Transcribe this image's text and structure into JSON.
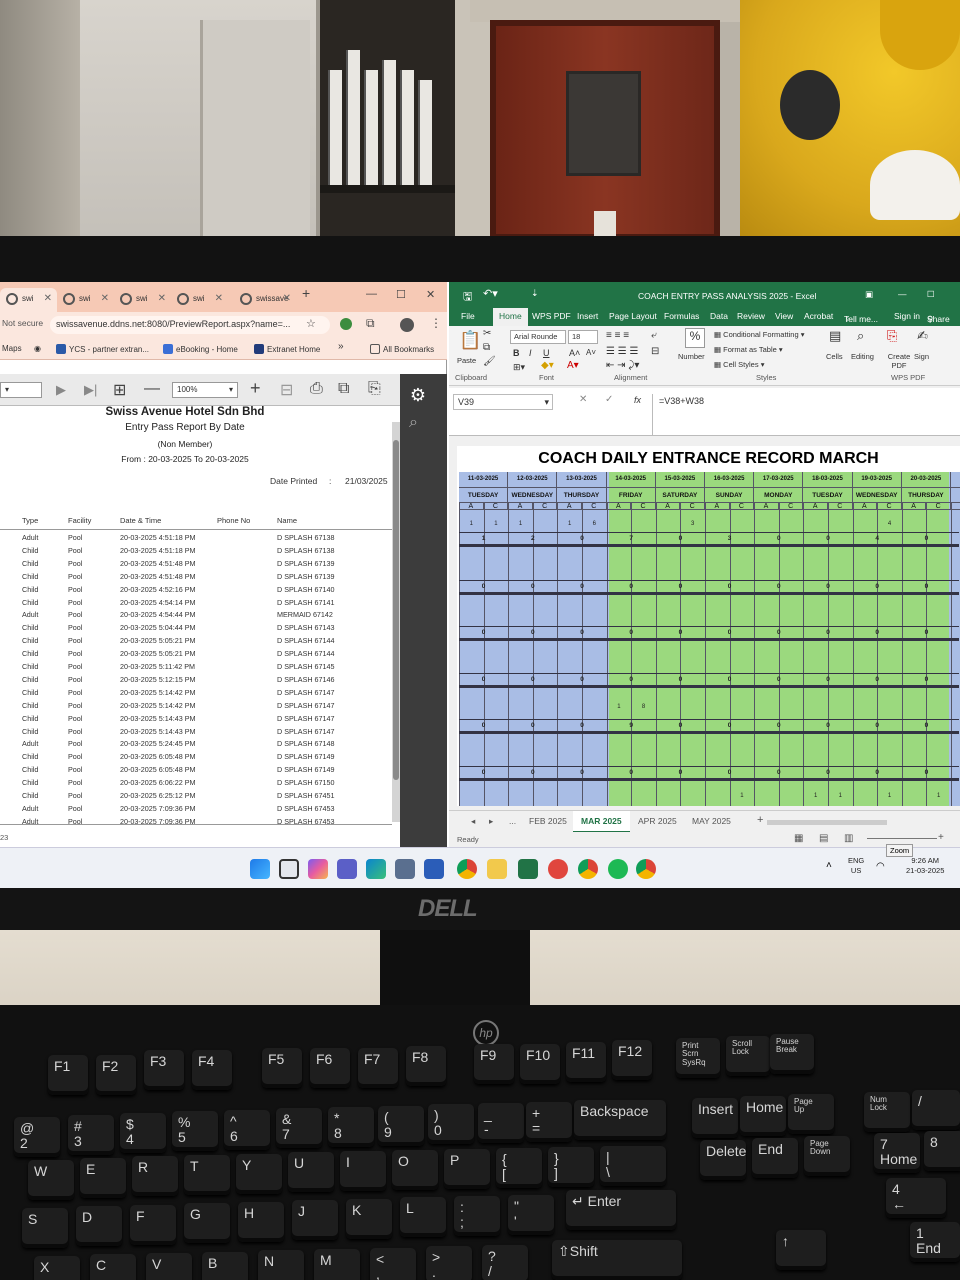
{
  "browser": {
    "tabs": [
      {
        "label": "swi",
        "active": true
      },
      {
        "label": "swi",
        "active": false
      },
      {
        "label": "swi",
        "active": false
      },
      {
        "label": "swi",
        "active": false
      },
      {
        "label": "swissave",
        "active": false
      }
    ],
    "not_secure": "Not secure",
    "url": "swissavenue.ddns.net:8080/PreviewReport.aspx?name=...",
    "bookmarks": [
      "Maps",
      "YCS - partner extran...",
      "eBooking - Home",
      "Extranet Home",
      "All Bookmarks"
    ],
    "zoom": "100%",
    "report": {
      "company": "Swiss Avenue Hotel Sdn Bhd",
      "title": "Entry Pass Report By Date",
      "subtitle": "(Non Member)",
      "range": "From : 20-03-2025 To 20-03-2025",
      "printed_label": "Date Printed",
      "printed_sep": ":",
      "printed_value": "21/03/2025",
      "columns": [
        "Type",
        "Facility",
        "Date & Time",
        "Phone No",
        "Name"
      ],
      "rows": [
        [
          "Adult",
          "Pool",
          "20-03-2025 4:51:18 PM",
          "D SPLASH 67138"
        ],
        [
          "Child",
          "Pool",
          "20-03-2025 4:51:18 PM",
          "D SPLASH 67138"
        ],
        [
          "Child",
          "Pool",
          "20-03-2025 4:51:48 PM",
          "D SPLASH 67139"
        ],
        [
          "Child",
          "Pool",
          "20-03-2025 4:51:48 PM",
          "D SPLASH 67139"
        ],
        [
          "Child",
          "Pool",
          "20-03-2025 4:52:16 PM",
          "D SPLASH 67140"
        ],
        [
          "Child",
          "Pool",
          "20-03-2025 4:54:14 PM",
          "D SPLASH 67141"
        ],
        [
          "Adult",
          "Pool",
          "20-03-2025 4:54:44 PM",
          "MERMAID 67142"
        ],
        [
          "Child",
          "Pool",
          "20-03-2025 5:04:44 PM",
          "D SPLASH 67143"
        ],
        [
          "Child",
          "Pool",
          "20-03-2025 5:05:21 PM",
          "D SPLASH 67144"
        ],
        [
          "Child",
          "Pool",
          "20-03-2025 5:05:21 PM",
          "D SPLASH 67144"
        ],
        [
          "Child",
          "Pool",
          "20-03-2025 5:11:42 PM",
          "D SPLASH 67145"
        ],
        [
          "Child",
          "Pool",
          "20-03-2025 5:12:15 PM",
          "D SPLASH 67146"
        ],
        [
          "Child",
          "Pool",
          "20-03-2025 5:14:42 PM",
          "D SPLASH 67147"
        ],
        [
          "Child",
          "Pool",
          "20-03-2025 5:14:42 PM",
          "D SPLASH 67147"
        ],
        [
          "Child",
          "Pool",
          "20-03-2025 5:14:43 PM",
          "D SPLASH 67147"
        ],
        [
          "Child",
          "Pool",
          "20-03-2025 5:14:43 PM",
          "D SPLASH 67147"
        ],
        [
          "Adult",
          "Pool",
          "20-03-2025 5:24:45 PM",
          "D SPLASH 67148"
        ],
        [
          "Child",
          "Pool",
          "20-03-2025 6:05:48 PM",
          "D SPLASH 67149"
        ],
        [
          "Child",
          "Pool",
          "20-03-2025 6:05:48 PM",
          "D SPLASH 67149"
        ],
        [
          "Child",
          "Pool",
          "20-03-2025 6:06:22 PM",
          "D SPLASH 67150"
        ],
        [
          "Child",
          "Pool",
          "20-03-2025 6:25:12 PM",
          "D SPLASH 67451"
        ],
        [
          "Adult",
          "Pool",
          "20-03-2025 7:09:36 PM",
          "D SPLASH 67453"
        ],
        [
          "Adult",
          "Pool",
          "20-03-2025 7:09:36 PM",
          "D SPLASH 67453"
        ]
      ],
      "page_indicator": "23"
    }
  },
  "excel": {
    "window_title": "COACH ENTRY PASS ANALYSIS 2025 - Excel",
    "menu": [
      "File",
      "Home",
      "WPS PDF",
      "Insert",
      "Page Layout",
      "Formulas",
      "Data",
      "Review",
      "View",
      "Acrobat",
      "Tell me...",
      "Sign in",
      "Share"
    ],
    "font_name": "Arial Rounde",
    "font_size": "18",
    "ribbon_labels": {
      "paste": "Paste",
      "number": "Number",
      "conditional": "Conditional Formatting",
      "format_table": "Format as Table",
      "cell_styles": "Cell Styles",
      "cells": "Cells",
      "editing": "Editing",
      "create_pdf": "Create PDF",
      "sign": "Sign",
      "clipboard": "Clipboard",
      "font": "Font",
      "alignment": "Alignment",
      "styles": "Styles",
      "wps_pdf": "WPS PDF"
    },
    "name_box": "V39",
    "formula": "=V38+W38",
    "sheet_title": "COACH DAILY ENTRANCE RECORD MARCH",
    "dates": [
      "11-03-2025",
      "12-03-2025",
      "13-03-2025",
      "14-03-2025",
      "15-03-2025",
      "16-03-2025",
      "17-03-2025",
      "18-03-2025",
      "19-03-2025",
      "20-03-2025",
      "21-0"
    ],
    "days": [
      "TUESDAY",
      "WEDNESDAY",
      "THURSDAY",
      "FRIDAY",
      "SATURDAY",
      "SUNDAY",
      "MONDAY",
      "TUESDAY",
      "WEDNESDAY",
      "THURSDAY",
      "F"
    ],
    "ac_label_a": "A",
    "ac_label_c": "C",
    "first_row_small": [
      "1",
      "1",
      "1",
      "",
      "1",
      "6",
      "",
      "",
      "",
      "3",
      "",
      "",
      "",
      "",
      "",
      "",
      "",
      "4",
      "",
      ""
    ],
    "totals": [
      [
        "1",
        "2",
        "0",
        "7",
        "0",
        "3",
        "0",
        "0",
        "4",
        "0"
      ],
      [
        "0",
        "0",
        "0",
        "0",
        "0",
        "0",
        "0",
        "0",
        "0",
        "0"
      ],
      [
        "0",
        "0",
        "0",
        "0",
        "0",
        "0",
        "0",
        "0",
        "0",
        "0"
      ],
      [
        "0",
        "0",
        "0",
        "0",
        "0",
        "0",
        "0",
        "0",
        "0",
        "0"
      ],
      [
        "0",
        "0",
        "0",
        "9",
        "0",
        "0",
        "0",
        "0",
        "0",
        "0"
      ],
      [
        "0",
        "0",
        "0",
        "0",
        "0",
        "0",
        "0",
        "0",
        "0",
        "0"
      ]
    ],
    "row5_small": [
      "1",
      "8"
    ],
    "bottom_small": [
      "1",
      "1",
      "1",
      "1",
      "1"
    ],
    "sheet_tabs": [
      "...",
      "FEB 2025",
      "MAR 2025",
      "APR 2025",
      "MAY 2025",
      "+"
    ],
    "status": "Ready"
  },
  "taskbar": {
    "lang": "ENG",
    "region": "US",
    "time": "9:26 AM",
    "date": "21-03-2025",
    "zoom_tooltip": "Zoom"
  },
  "monitor_brand": "DELL",
  "keyboard_brand": "hp",
  "keys": {
    "f1": "F1",
    "f2": "F2",
    "f3": "F3",
    "f4": "F4",
    "f5": "F5",
    "f6": "F6",
    "f7": "F7",
    "f8": "F8",
    "f9": "F9",
    "f10": "F10",
    "f11": "F11",
    "f12": "F12",
    "prtsc": "Print\nScrn\nSysRq",
    "scroll": "Scroll\nLock",
    "pause": "Pause\nBreak",
    "n2": "@\n2",
    "n3": "#\n3",
    "n4": "$\n4",
    "n5": "%\n5",
    "n6": "^\n6",
    "n7": "&\n7",
    "n8": "*\n8",
    "n9": "(\n9",
    "n0": ")\n0",
    "minus": "_\n-",
    "equal": "+\n=",
    "backspace": "Backspace",
    "insert": "Insert",
    "home": "Home",
    "pageup": "Page\nUp",
    "numlock": "Num\nLock",
    "slash": "/",
    "q": "",
    "w": "W",
    "e": "E",
    "r": "R",
    "t": "T",
    "y": "Y",
    "u": "U",
    "i": "I",
    "o": "O",
    "p": "P",
    "lbracket": "{\n[",
    "rbracket": "}\n]",
    "backslash": "|\n\\",
    "delete": "Delete",
    "end": "End",
    "pagedown": "Page\nDown",
    "np7": "7\nHome",
    "np8": "8",
    "a": "",
    "s": "S",
    "d": "D",
    "f": "F",
    "g": "G",
    "h": "H",
    "j": "J",
    "k": "K",
    "l": "L",
    "semicolon": ":\n;",
    "quote": "\"\n'",
    "enter": "↵ Enter",
    "np4": "4\n←",
    "z": "",
    "x": "X",
    "c": "C",
    "v": "V",
    "b": "B",
    "n": "N",
    "m": "M",
    "comma": "<\n,",
    "period": ">\n.",
    "question": "?\n/",
    "shift": "⇧Shift",
    "up": "↑",
    "np1": "1\nEnd"
  }
}
